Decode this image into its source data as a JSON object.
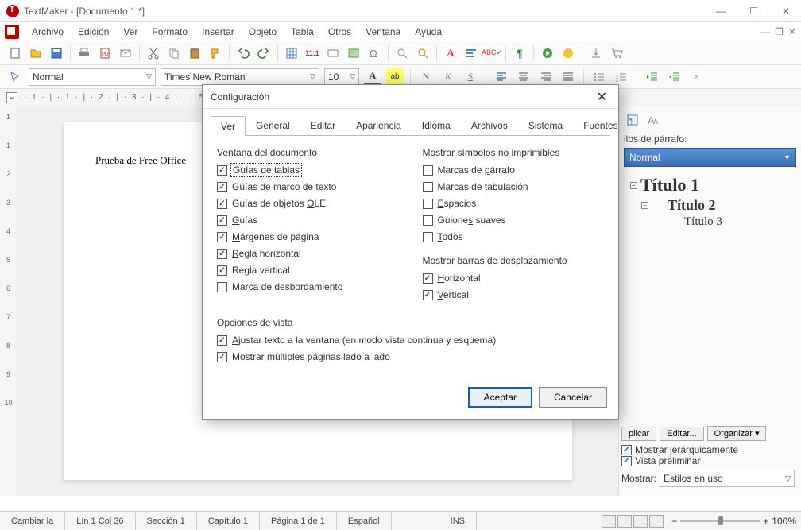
{
  "titlebar": {
    "title": "TextMaker - [Documento 1 *]"
  },
  "menu": [
    "Archivo",
    "Edición",
    "Ver",
    "Formato",
    "Insertar",
    "Objeto",
    "Tabla",
    "Otros",
    "Ventana",
    "Ayuda"
  ],
  "style_dropdown": "Normal",
  "font_dropdown": "Times New Roman",
  "size_dropdown": "10",
  "ruler_text": "· 1 · | · 1 · | · 2 · | · 3 · | · 4 · | · 5 · | · 6 · | · 7 · |",
  "doc_text": "Prueba de Free Office",
  "sidebar": {
    "label": "ilos de párrafo:",
    "normal": "Normal",
    "h1": "Título 1",
    "h2": "Título 2",
    "h3": "Título 3",
    "aplicar": "plicar",
    "editar": "Editar...",
    "organizar": "Organizar ▾",
    "jerarq": "Mostrar jerárquicamente",
    "preliminar": "Vista preliminar",
    "mostrar_label": "Mostrar:",
    "mostrar_val": "Estilos en uso"
  },
  "dialog": {
    "title": "Configuración",
    "tabs": [
      "Ver",
      "General",
      "Editar",
      "Apariencia",
      "Idioma",
      "Archivos",
      "Sistema",
      "Fuentes"
    ],
    "group1_title": "Ventana del documento",
    "group1": [
      {
        "label": "Guías de tablas",
        "checked": true,
        "focused": true,
        "u": null
      },
      {
        "label": "Guías de marco de texto",
        "checked": true,
        "u": "m"
      },
      {
        "label": "Guías de objetos OLE",
        "checked": true,
        "u": "O"
      },
      {
        "label": "Guías",
        "checked": true,
        "u": "G"
      },
      {
        "label": "Márgenes de página",
        "checked": true,
        "u": "M"
      },
      {
        "label": "Regla horizontal",
        "checked": true,
        "u": "R"
      },
      {
        "label": "Regla vertical",
        "checked": true,
        "u": null
      },
      {
        "label": "Marca de desbordamiento",
        "checked": false,
        "u": null
      }
    ],
    "group2_title": "Mostrar símbolos no imprimibles",
    "group2": [
      {
        "label": "Marcas de párrafo",
        "checked": false,
        "u": "p"
      },
      {
        "label": "Marcas de tabulación",
        "checked": false,
        "u": "t"
      },
      {
        "label": "Espacios",
        "checked": false,
        "u": "E"
      },
      {
        "label": "Guiones suaves",
        "checked": false,
        "u": "s"
      },
      {
        "label": "Todos",
        "checked": false,
        "u": "T"
      }
    ],
    "group3_title": "Mostrar barras de desplazamiento",
    "group3": [
      {
        "label": "Horizontal",
        "checked": true,
        "u": "H"
      },
      {
        "label": "Vertical",
        "checked": true,
        "u": "V"
      }
    ],
    "group4_title": "Opciones de vista",
    "group4": [
      {
        "label": "Ajustar texto a la ventana (en modo vista continua y esquema)",
        "checked": true,
        "u": "A"
      },
      {
        "label": "Mostrar múltiples páginas lado a lado",
        "checked": true,
        "u": null
      }
    ],
    "ok": "Aceptar",
    "cancel": "Cancelar"
  },
  "status": {
    "s1": "Cambiar la",
    "s2": "Lín 1 Col 36",
    "s3": "Sección 1",
    "s4": "Capítulo 1",
    "s5": "Página 1 de 1",
    "s6": "Español",
    "s7": "INS",
    "zoom": "100%"
  }
}
